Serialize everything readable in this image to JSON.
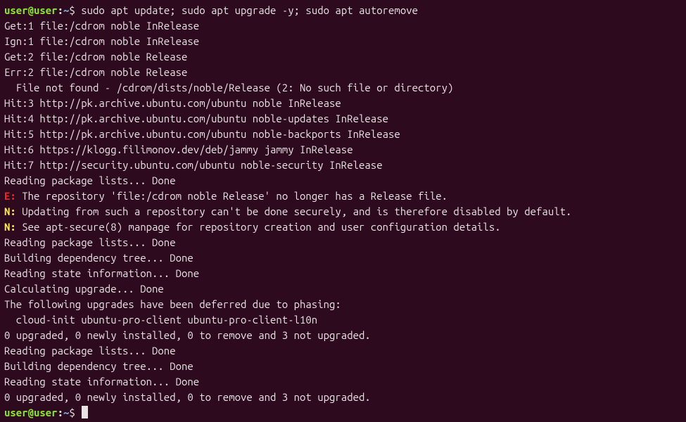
{
  "prompt": {
    "user_host": "user@user",
    "colon": ":",
    "path": "~",
    "symbol": "$"
  },
  "command": "sudo apt update; sudo apt upgrade -y; sudo apt autoremove",
  "lines": [
    {
      "type": "output",
      "text": "Get:1 file:/cdrom noble InRelease"
    },
    {
      "type": "output",
      "text": "Ign:1 file:/cdrom noble InRelease"
    },
    {
      "type": "output",
      "text": "Get:2 file:/cdrom noble Release"
    },
    {
      "type": "output",
      "text": "Err:2 file:/cdrom noble Release"
    },
    {
      "type": "output",
      "text": "  File not found - /cdrom/dists/noble/Release (2: No such file or directory)"
    },
    {
      "type": "output",
      "text": "Hit:3 http://pk.archive.ubuntu.com/ubuntu noble InRelease"
    },
    {
      "type": "output",
      "text": "Hit:4 http://pk.archive.ubuntu.com/ubuntu noble-updates InRelease"
    },
    {
      "type": "output",
      "text": "Hit:5 http://pk.archive.ubuntu.com/ubuntu noble-backports InRelease"
    },
    {
      "type": "output",
      "text": "Hit:6 https://klogg.filimonov.dev/deb/jammy jammy InRelease"
    },
    {
      "type": "output",
      "text": "Hit:7 http://security.ubuntu.com/ubuntu noble-security InRelease"
    },
    {
      "type": "output",
      "text": "Reading package lists... Done"
    },
    {
      "type": "tagged",
      "tag": "E:",
      "tag_class": "error-tag",
      "text": " The repository 'file:/cdrom noble Release' no longer has a Release file."
    },
    {
      "type": "tagged",
      "tag": "N:",
      "tag_class": "notice-tag",
      "text": " Updating from such a repository can't be done securely, and is therefore disabled by default."
    },
    {
      "type": "tagged",
      "tag": "N:",
      "tag_class": "notice-tag",
      "text": " See apt-secure(8) manpage for repository creation and user configuration details."
    },
    {
      "type": "output",
      "text": "Reading package lists... Done"
    },
    {
      "type": "output",
      "text": "Building dependency tree... Done"
    },
    {
      "type": "output",
      "text": "Reading state information... Done"
    },
    {
      "type": "output",
      "text": "Calculating upgrade... Done"
    },
    {
      "type": "output",
      "text": "The following upgrades have been deferred due to phasing:"
    },
    {
      "type": "output",
      "text": "  cloud-init ubuntu-pro-client ubuntu-pro-client-l10n"
    },
    {
      "type": "output",
      "text": "0 upgraded, 0 newly installed, 0 to remove and 3 not upgraded."
    },
    {
      "type": "output",
      "text": "Reading package lists... Done"
    },
    {
      "type": "output",
      "text": "Building dependency tree... Done"
    },
    {
      "type": "output",
      "text": "Reading state information... Done"
    },
    {
      "type": "output",
      "text": "0 upgraded, 0 newly installed, 0 to remove and 3 not upgraded."
    }
  ]
}
